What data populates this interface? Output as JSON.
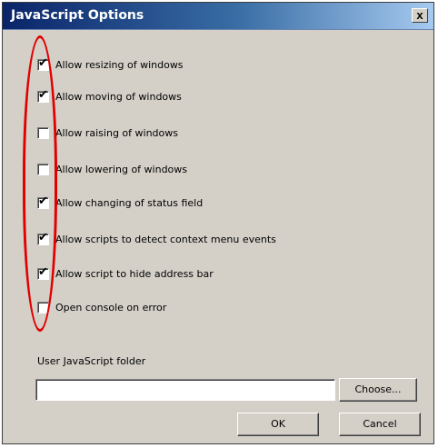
{
  "window": {
    "title": "JavaScript Options",
    "close_label": "x"
  },
  "options": [
    {
      "label": "Allow resizing of windows",
      "checked": true
    },
    {
      "label": "Allow moving of windows",
      "checked": true
    },
    {
      "label": "Allow raising of windows",
      "checked": false
    },
    {
      "label": "Allow lowering of windows",
      "checked": false
    },
    {
      "label": "Allow changing of status field",
      "checked": true
    },
    {
      "label": "Allow scripts to detect context menu events",
      "checked": true
    },
    {
      "label": "Allow script to hide address bar",
      "checked": true
    },
    {
      "label": "Open console on error",
      "checked": false
    }
  ],
  "folder": {
    "label": "User JavaScript folder",
    "value": ""
  },
  "buttons": {
    "choose": "Choose...",
    "ok": "OK",
    "cancel": "Cancel"
  },
  "colors": {
    "title_gradient_start": "#0a246a",
    "title_gradient_end": "#a6caf0",
    "dialog_bg": "#d4d0c8",
    "annotation": "#e00000"
  },
  "icons": {
    "check": "checkmark-icon",
    "close": "close-icon"
  }
}
